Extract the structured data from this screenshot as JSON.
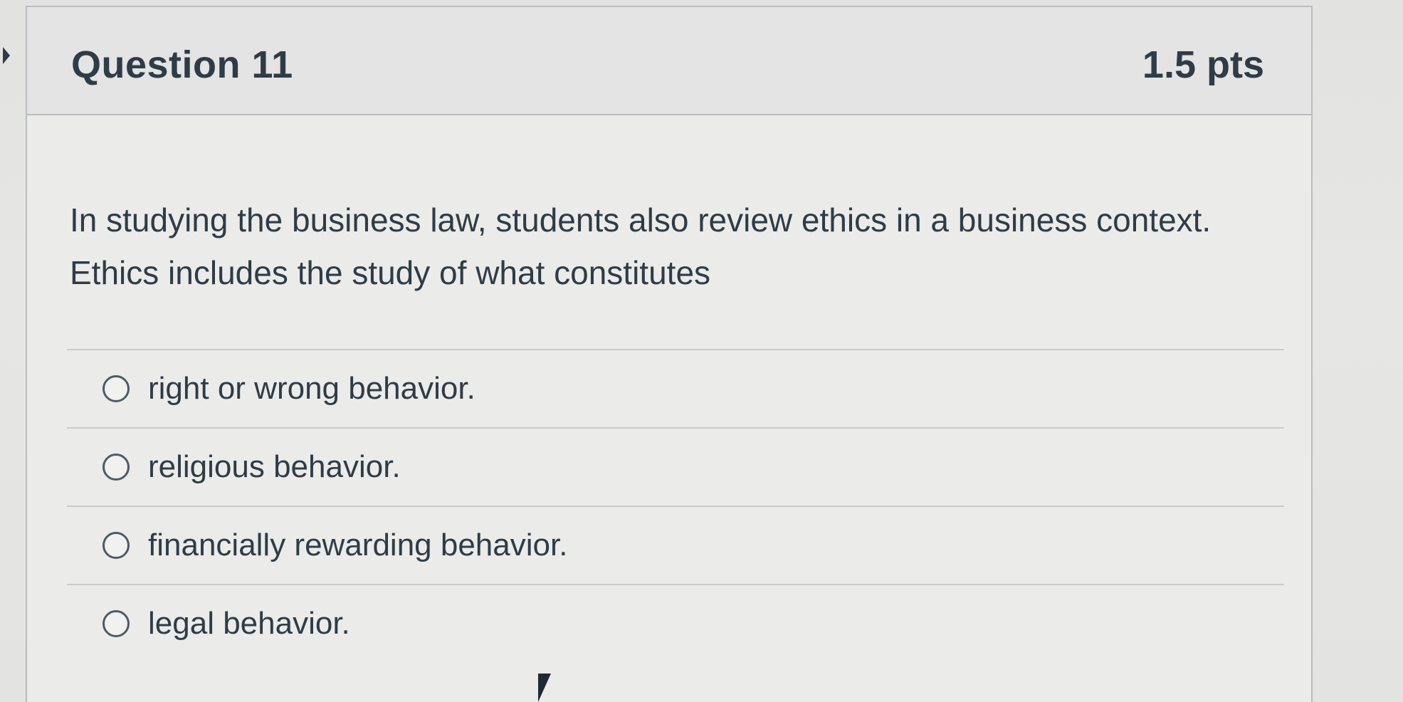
{
  "question": {
    "title": "Question 11",
    "points": "1.5 pts",
    "text": "In studying the business law, students also review ethics in a business context. Ethics includes the study of what constitutes",
    "answers": [
      {
        "label": "right or wrong behavior."
      },
      {
        "label": "religious behavior."
      },
      {
        "label": "financially rewarding behavior."
      },
      {
        "label": "legal behavior."
      }
    ]
  },
  "icons": {
    "radio": "radio-unselected-icon",
    "cursor": "mouse-pointer-icon"
  }
}
